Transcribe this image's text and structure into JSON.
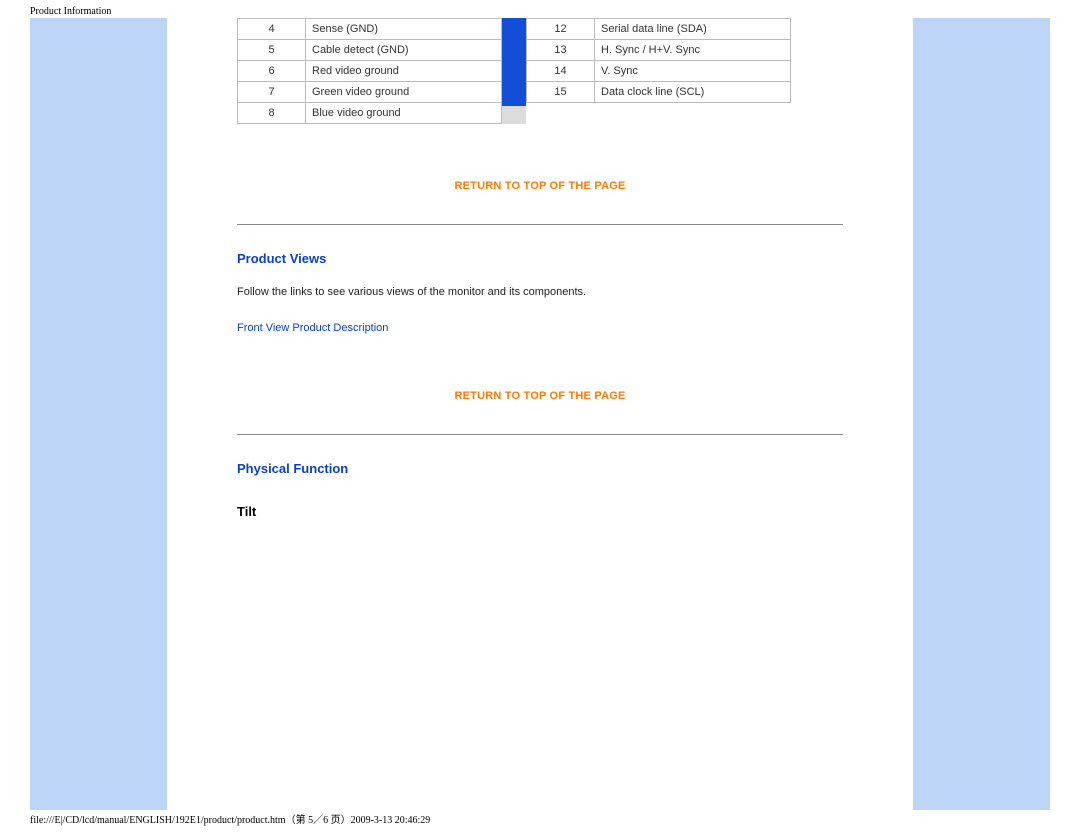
{
  "header_title": "Product Information",
  "pin_left": [
    {
      "n": "4",
      "d": "Sense (GND)"
    },
    {
      "n": "5",
      "d": "Cable detect (GND)"
    },
    {
      "n": "6",
      "d": "Red video ground"
    },
    {
      "n": "7",
      "d": "Green video ground"
    },
    {
      "n": "8",
      "d": "Blue video ground"
    }
  ],
  "pin_right": [
    {
      "n": "12",
      "d": "Serial data line (SDA)"
    },
    {
      "n": "13",
      "d": "H. Sync / H+V. Sync"
    },
    {
      "n": "14",
      "d": "V. Sync"
    },
    {
      "n": "15",
      "d": "Data clock line (SCL)"
    }
  ],
  "return_label": "RETURN TO TOP OF THE PAGE",
  "sections": {
    "product_views": {
      "heading": "Product Views",
      "intro": "Follow the links to see various views of the monitor and its components.",
      "link": "Front View Product Description"
    },
    "physical_function": {
      "heading": "Physical Function",
      "sub": "Tilt"
    }
  },
  "footer": "file:///E|/CD/lcd/manual/ENGLISH/192E1/product/product.htm（第 5／6 页）2009-3-13 20:46:29"
}
